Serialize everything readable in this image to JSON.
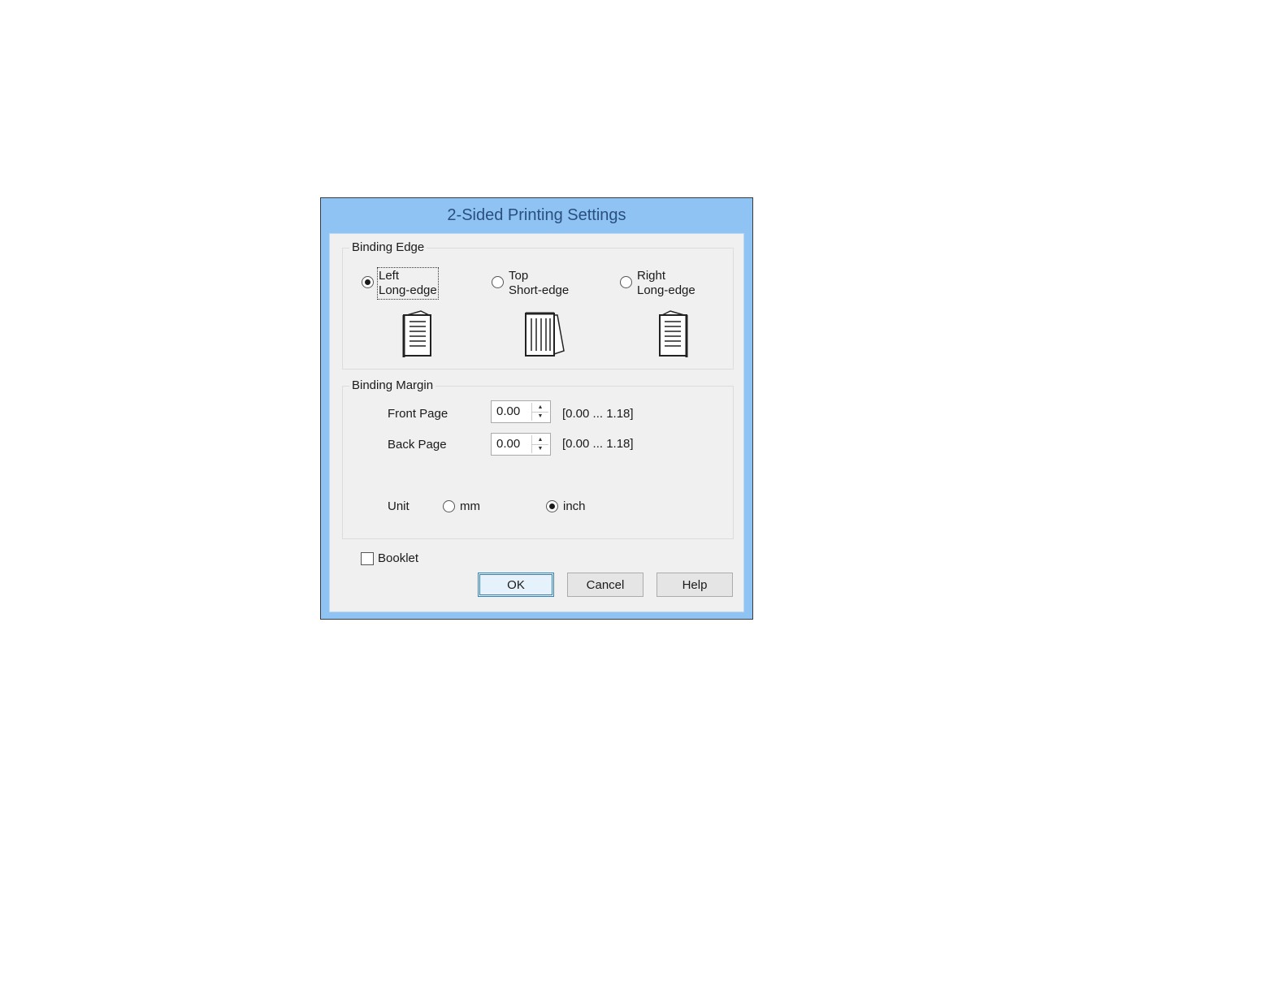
{
  "dialog": {
    "title": "2-Sided Printing Settings"
  },
  "binding_edge": {
    "group_title": "Binding Edge",
    "options": [
      {
        "line1": "Left",
        "line2": "Long-edge",
        "selected": true,
        "icon": "left-bound-document-icon"
      },
      {
        "line1": "Top",
        "line2": "Short-edge",
        "selected": false,
        "icon": "top-bound-document-icon"
      },
      {
        "line1": "Right",
        "line2": "Long-edge",
        "selected": false,
        "icon": "right-bound-document-icon"
      }
    ]
  },
  "binding_margin": {
    "group_title": "Binding Margin",
    "front_page": {
      "label": "Front Page",
      "value": "0.00",
      "range": "[0.00 ... 1.18]"
    },
    "back_page": {
      "label": "Back Page",
      "value": "0.00",
      "range": "[0.00 ... 1.18]"
    },
    "unit": {
      "label": "Unit",
      "options": [
        {
          "label": "mm",
          "selected": false
        },
        {
          "label": "inch",
          "selected": true
        }
      ]
    }
  },
  "booklet": {
    "label": "Booklet",
    "checked": false
  },
  "buttons": {
    "ok": "OK",
    "cancel": "Cancel",
    "help": "Help"
  }
}
